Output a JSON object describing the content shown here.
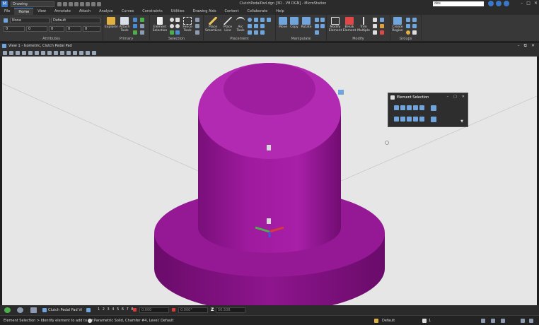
{
  "app": {
    "workflow": "Drawing",
    "title": "ClutchPedalPad.dgn [3D - V8 DGN] - MicroStation",
    "search_value": "des"
  },
  "tabs": [
    "File",
    "Home",
    "View",
    "Annotate",
    "Attach",
    "Analyze",
    "Curves",
    "Constraints",
    "Utilities",
    "Drawing Aids",
    "Content",
    "Collaborate",
    "Help"
  ],
  "active_tab": "Home",
  "ribbon": {
    "attributes": {
      "level": "None",
      "style": "Default",
      "weight": "0",
      "color": "0",
      "priority": "0",
      "transparency": "0",
      "label": "Attributes"
    },
    "primary": {
      "explorer": "Explorer",
      "attach_tools": "Attach Tools",
      "label": "Primary"
    },
    "selection": {
      "element_selection": "Element Selection",
      "fence_tools": "Fence Tools",
      "label": "Selection"
    },
    "placement": {
      "smartline": "Place SmartLine",
      "line": "Place Line",
      "arc": "Arc Tools",
      "label": "Placement"
    },
    "manipulate": {
      "move": "Move",
      "copy": "Copy",
      "rotate": "Rotate",
      "label": "Manipulate"
    },
    "modify": {
      "modify": "Modify Element",
      "break": "Break Element",
      "trim": "Trim Multiple",
      "label": "Modify"
    },
    "groups": {
      "create_region": "Create Region",
      "label": "Groups"
    }
  },
  "view": {
    "title": "View 1 - Isometric, Clutch Pedal Pad"
  },
  "element_selection_dialog": {
    "title": "Element Selection"
  },
  "bottom": {
    "model": "Clutch Pedal Pad Vi",
    "view_numbers": "1 2 3 4 5 6 7 8",
    "x": "0.000",
    "angle": "0.000°",
    "z_label": "Z",
    "z": "50.508"
  },
  "status": {
    "prompt": "Element Selection > Identify element to add to set",
    "info": "Parametric Solid, Chamfer #4, Level: Default",
    "level": "Default",
    "count": "1"
  },
  "colors": {
    "solid": "#9a189a",
    "solid_dark": "#6e0d6e",
    "solid_light": "#b828b8",
    "viewport_bg": "#e6e6e6",
    "accent": "#4b8bd4"
  }
}
